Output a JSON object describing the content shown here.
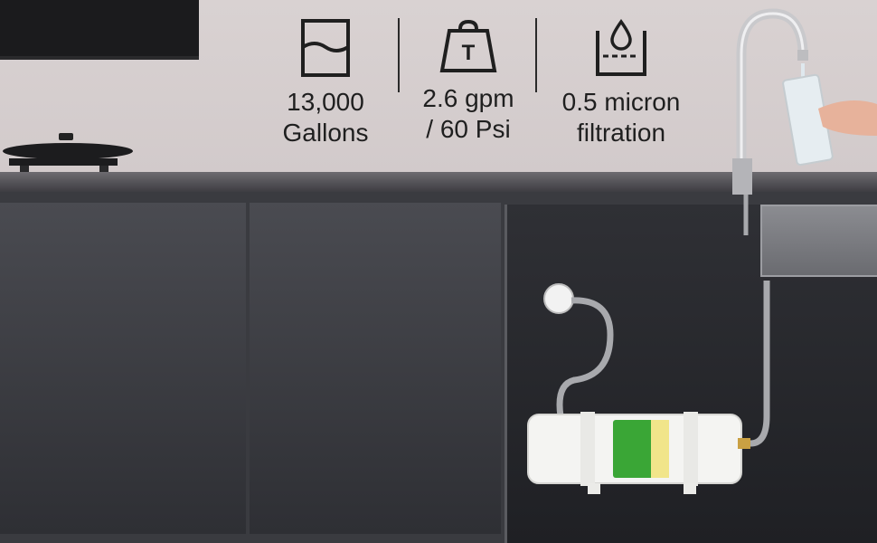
{
  "features": [
    {
      "icon": "capacity-icon",
      "label": "13,000\nGallons"
    },
    {
      "icon": "weight-icon",
      "label": "2.6 gpm\n/ 60 Psi"
    },
    {
      "icon": "water-drop-beaker-icon",
      "label": "0.5 micron\nfiltration"
    }
  ],
  "weight_icon_letter": "T",
  "colors": {
    "background": "#d4cdcd",
    "cabinet": "#3a3b40",
    "filter_body": "#f4f4f2",
    "filter_label": "#3aa636",
    "text": "#1f1f1f"
  }
}
